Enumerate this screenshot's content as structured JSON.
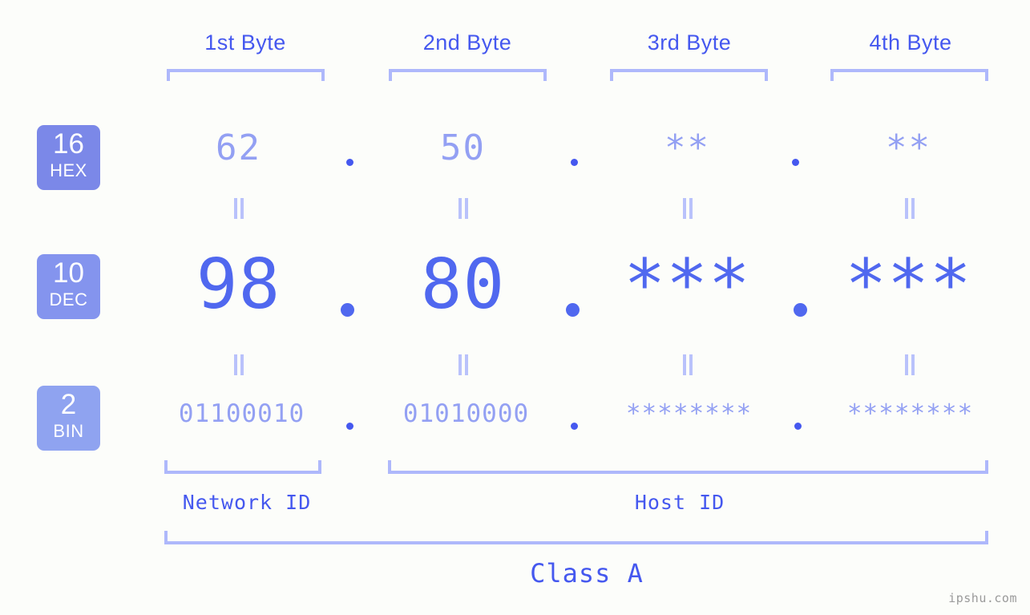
{
  "background_color": "#fcfdfa",
  "accent_color": "#4558ef",
  "accent_light_color": "#93a0f3",
  "bracket_color": "#aeb8fb",
  "headers": [
    {
      "label": "1st Byte"
    },
    {
      "label": "2nd Byte"
    },
    {
      "label": "3rd Byte"
    },
    {
      "label": "4th Byte"
    }
  ],
  "bases": [
    {
      "number": "16",
      "name": "HEX",
      "color": "#7b88e8"
    },
    {
      "number": "10",
      "name": "DEC",
      "color": "#8494ee"
    },
    {
      "number": "2",
      "name": "BIN",
      "color": "#8fa3f0"
    }
  ],
  "rows": {
    "hex": {
      "base_number": "16",
      "base_name": "HEX",
      "values": [
        "62",
        "50",
        "**",
        "**"
      ],
      "separator": "."
    },
    "dec": {
      "base_number": "10",
      "base_name": "DEC",
      "values": [
        "98",
        "80",
        "***",
        "***"
      ],
      "separator": "."
    },
    "bin": {
      "base_number": "2",
      "base_name": "BIN",
      "values": [
        "01100010",
        "01010000",
        "********",
        "********"
      ],
      "separator": "."
    }
  },
  "equality_symbol": "=",
  "segments": {
    "network_id": "Network ID",
    "host_id": "Host ID",
    "class": "Class A"
  },
  "watermark": "ipshu.com"
}
